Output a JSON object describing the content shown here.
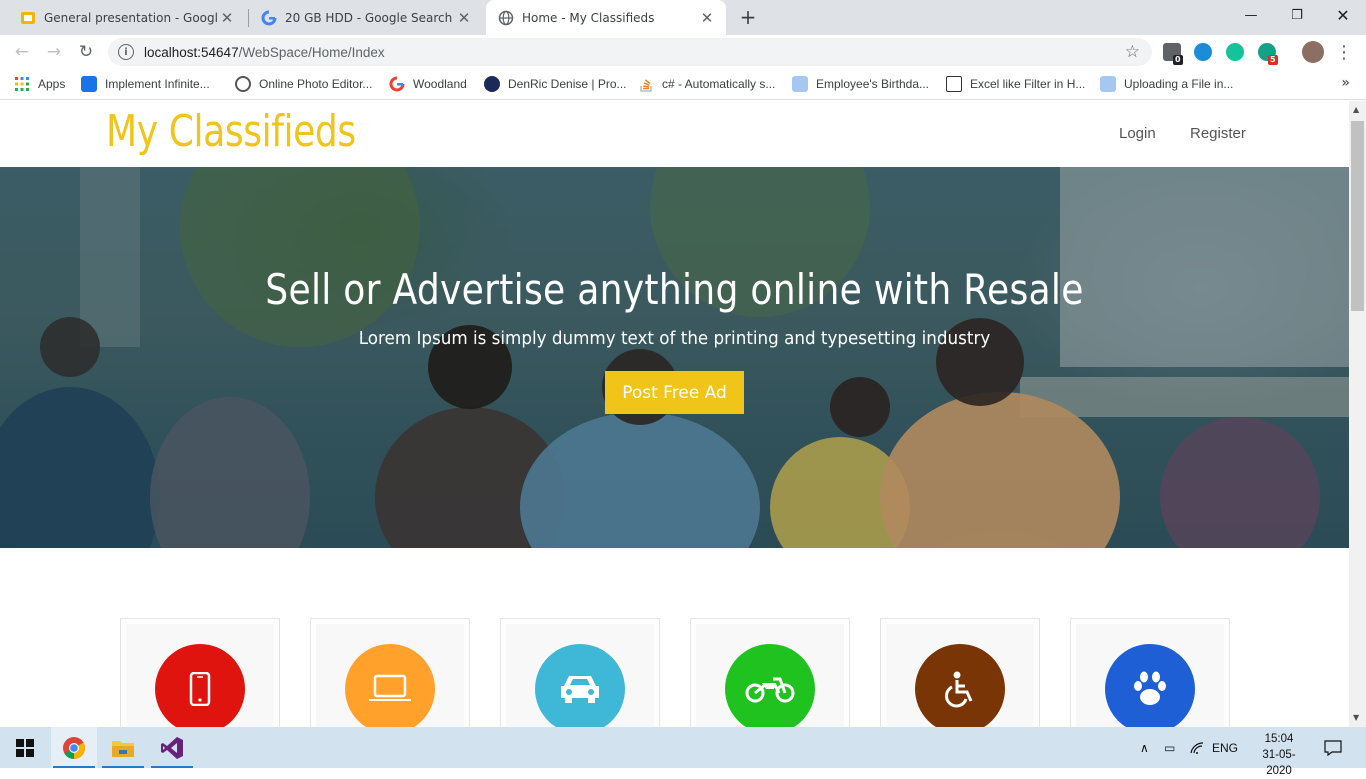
{
  "browser": {
    "tabs": [
      {
        "title": "General presentation - Google Sl",
        "icon": "slides-icon",
        "active": false
      },
      {
        "title": "20 GB HDD - Google Search",
        "icon": "google-icon",
        "active": false
      },
      {
        "title": "Home - My Classifieds",
        "icon": "globe-icon",
        "active": true
      }
    ],
    "url_host": "localhost:54647",
    "url_path": "/WebSpace/Home/Index",
    "extension_badges": {
      "first": "0",
      "fifth": "5"
    },
    "bookmarks": [
      {
        "label": "Apps",
        "icon": "apps-grid-icon"
      },
      {
        "label": "Implement Infinite...",
        "icon": "asp-icon"
      },
      {
        "label": "Online Photo Editor...",
        "icon": "aperture-icon"
      },
      {
        "label": "Woodland",
        "icon": "google-icon"
      },
      {
        "label": "DenRic Denise | Pro...",
        "icon": "circle-logo-icon"
      },
      {
        "label": "c# - Automatically s...",
        "icon": "stackoverflow-icon"
      },
      {
        "label": "Employee's Birthda...",
        "icon": "pin-icon"
      },
      {
        "label": "Excel like Filter in H...",
        "icon": "download-box-icon"
      },
      {
        "label": "Uploading a File in...",
        "icon": "pin-icon"
      }
    ]
  },
  "site": {
    "brand": "My Classifieds",
    "nav": {
      "login": "Login",
      "register": "Register"
    },
    "hero": {
      "title": "Sell or Advertise anything online with Resale",
      "subtitle": "Lorem Ipsum is simply dummy text of the printing and typesetting industry",
      "cta": "Post Free Ad"
    },
    "categories": [
      {
        "icon": "mobile-phone-icon",
        "color": "#e0140f"
      },
      {
        "icon": "laptop-icon",
        "color": "#ffa12b"
      },
      {
        "icon": "car-icon",
        "color": "#3fb7d6"
      },
      {
        "icon": "motorcycle-icon",
        "color": "#1fc21f"
      },
      {
        "icon": "wheelchair-icon",
        "color": "#7a3507"
      },
      {
        "icon": "paw-icon",
        "color": "#1f5fd6"
      }
    ],
    "brand_color": "#f0c419"
  },
  "taskbar": {
    "language": "ENG",
    "time": "15:04",
    "date": "31-05-2020"
  }
}
